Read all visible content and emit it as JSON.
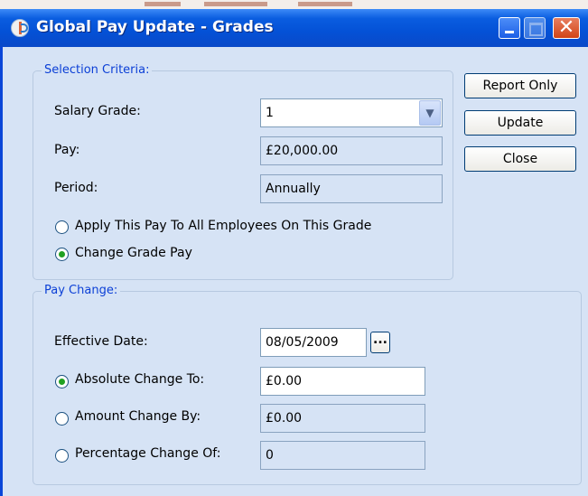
{
  "window": {
    "title": "Global Pay Update - Grades",
    "controls": {
      "minimize": "minimize-icon",
      "maximize": "maximize-icon",
      "close": "close-icon",
      "close_glyph": "✕"
    }
  },
  "selection_criteria": {
    "legend": "Selection Criteria:",
    "salary_grade_label": "Salary Grade:",
    "salary_grade_value": "1",
    "pay_label": "Pay:",
    "pay_value": "£20,000.00",
    "period_label": "Period:",
    "period_value": "Annually",
    "option_apply_all": "Apply This Pay To All Employees On This Grade",
    "option_change_grade_pay": "Change Grade Pay",
    "selected_option": "change_grade_pay"
  },
  "pay_change": {
    "legend": "Pay Change:",
    "effective_date_label": "Effective Date:",
    "effective_date_value": "08/05/2009",
    "date_picker_label": "...",
    "absolute_label": "Absolute Change To:",
    "absolute_value": "£0.00",
    "amount_label": "Amount Change By:",
    "amount_value": "£0.00",
    "percentage_label": "Percentage Change Of:",
    "percentage_value": "0",
    "selected_option": "absolute"
  },
  "buttons": {
    "report_only": "Report Only",
    "update": "Update",
    "close": "Close"
  },
  "colors": {
    "titlebar": "#0451d6",
    "window_bg": "#d6e3f5",
    "legend_text": "#0b3fd6",
    "radio_dot": "#21a121"
  }
}
